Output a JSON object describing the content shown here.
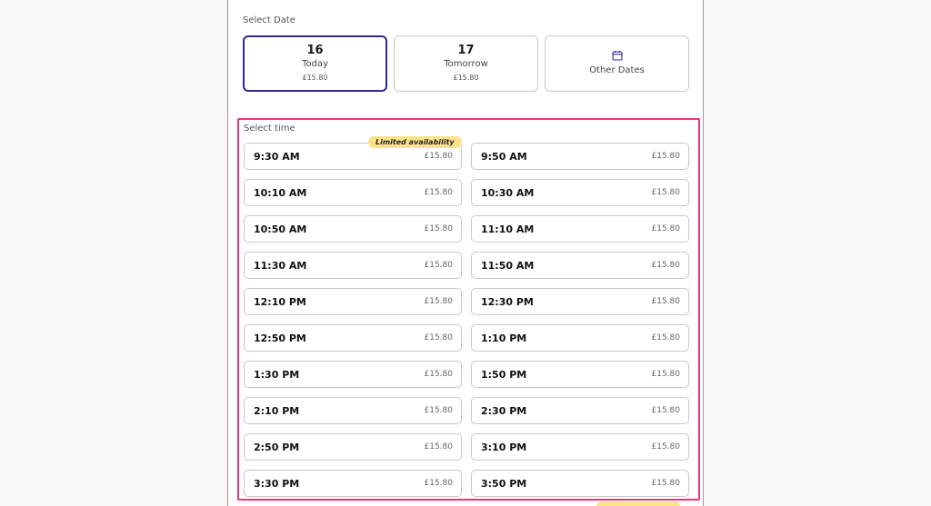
{
  "date_section": {
    "label": "Select Date",
    "cards": [
      {
        "day": "16",
        "name": "Today",
        "price": "£15.80",
        "selected": true
      },
      {
        "day": "17",
        "name": "Tomorrow",
        "price": "£15.80",
        "selected": false
      }
    ],
    "other": {
      "label": "Other Dates",
      "icon": "calendar-icon"
    }
  },
  "time_section": {
    "label": "Select time",
    "highlight_color": "#e8357c",
    "badge_label": "Limited availability",
    "slots": [
      {
        "time": "9:30 AM",
        "price": "£15.80"
      },
      {
        "time": "9:50 AM",
        "price": "£15.80"
      },
      {
        "time": "10:10 AM",
        "price": "£15.80"
      },
      {
        "time": "10:30 AM",
        "price": "£15.80"
      },
      {
        "time": "10:50 AM",
        "price": "£15.80"
      },
      {
        "time": "11:10 AM",
        "price": "£15.80"
      },
      {
        "time": "11:30 AM",
        "price": "£15.80"
      },
      {
        "time": "11:50 AM",
        "price": "£15.80"
      },
      {
        "time": "12:10 PM",
        "price": "£15.80"
      },
      {
        "time": "12:30 PM",
        "price": "£15.80"
      },
      {
        "time": "12:50 PM",
        "price": "£15.80"
      },
      {
        "time": "1:10 PM",
        "price": "£15.80"
      },
      {
        "time": "1:30 PM",
        "price": "£15.80"
      },
      {
        "time": "1:50 PM",
        "price": "£15.80"
      },
      {
        "time": "2:10 PM",
        "price": "£15.80"
      },
      {
        "time": "2:30 PM",
        "price": "£15.80"
      },
      {
        "time": "2:50 PM",
        "price": "£15.80"
      },
      {
        "time": "3:10 PM",
        "price": "£15.80"
      },
      {
        "time": "3:30 PM",
        "price": "£15.80"
      },
      {
        "time": "3:50 PM",
        "price": "£15.80"
      }
    ]
  },
  "colors": {
    "selected_border": "#2d2a8c",
    "badge_bg": "#fbe38c"
  }
}
